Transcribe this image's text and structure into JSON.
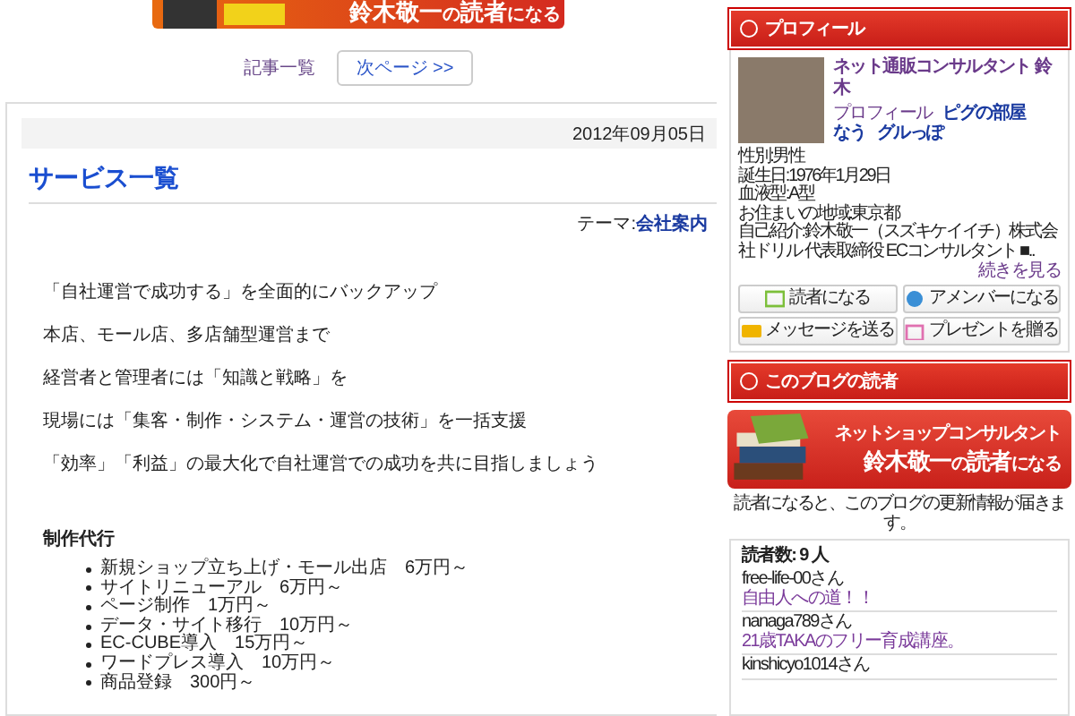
{
  "top_banner": {
    "name": "鈴木敬一",
    "particle": "の",
    "word": "読者",
    "suffix": "になる"
  },
  "pager": {
    "index_link": "記事一覧",
    "next_button": "次ページ >>"
  },
  "article": {
    "date": "2012年09月05日",
    "title": "サービス一覧",
    "theme_label": "テーマ:",
    "theme_link": "会社案内",
    "paragraphs": [
      "「自社運営で成功する」を全面的にバックアップ",
      "本店、モール店、多店舗型運営まで",
      "経営者と管理者には「知識と戦略」を",
      "現場には「集客・制作・システム・運営の技術」を一括支援",
      "「効率」「利益」の最大化で自社運営での成功を共に目指しましょう"
    ],
    "section_heading": "制作代行",
    "list": [
      "新規ショップ立ち上げ・モール出店　6万円～",
      "サイトリニューアル　6万円～",
      "ページ制作　1万円～",
      "データ・サイト移行　10万円～",
      "EC-CUBE導入　15万円～",
      "ワードプレス導入　10万円～",
      "商品登録　300円～"
    ]
  },
  "profile": {
    "heading": "プロフィール",
    "name": "ネット通販コンサルタント 鈴木",
    "links": [
      {
        "text": "プロフィール",
        "kind": "plain"
      },
      {
        "text": "ピグの部屋",
        "kind": "bold"
      },
      {
        "text": "なう",
        "kind": "bold"
      },
      {
        "text": "グルっぽ",
        "kind": "bold"
      }
    ],
    "facts": [
      "性別:男性",
      "誕生日:1976年1月29日",
      "血液型:A型",
      "お住まいの地域:東京都",
      "自己紹介:鈴木敬一（スズキケイイチ）株式会社ドリル 代表取締役 ECコンサルタント ■.."
    ],
    "more_link": "続きを見る",
    "buttons": [
      {
        "label": "読者になる",
        "kind": "reader"
      },
      {
        "label": "アメンバーになる",
        "kind": "amember"
      },
      {
        "label": "メッセージを送る",
        "kind": "message"
      },
      {
        "label": "プレゼントを贈る",
        "kind": "present"
      }
    ]
  },
  "readers": {
    "heading": "このブログの読者",
    "banner_subtitle": "ネットショップコンサルタント",
    "banner_name": "鈴木敬一",
    "banner_particle": "の",
    "banner_word": "読者",
    "banner_suffix": "になる",
    "note": "読者になると、このブログの更新情報が届きます。",
    "count": "読者数: 9 人",
    "items": [
      {
        "user": "free-life-00さん",
        "blog": "自由人への道！！"
      },
      {
        "user": "nanaga789さん",
        "blog": "21歳TAKAのフリー育成講座。"
      },
      {
        "user": "kinshicyo1014さん"
      }
    ]
  }
}
